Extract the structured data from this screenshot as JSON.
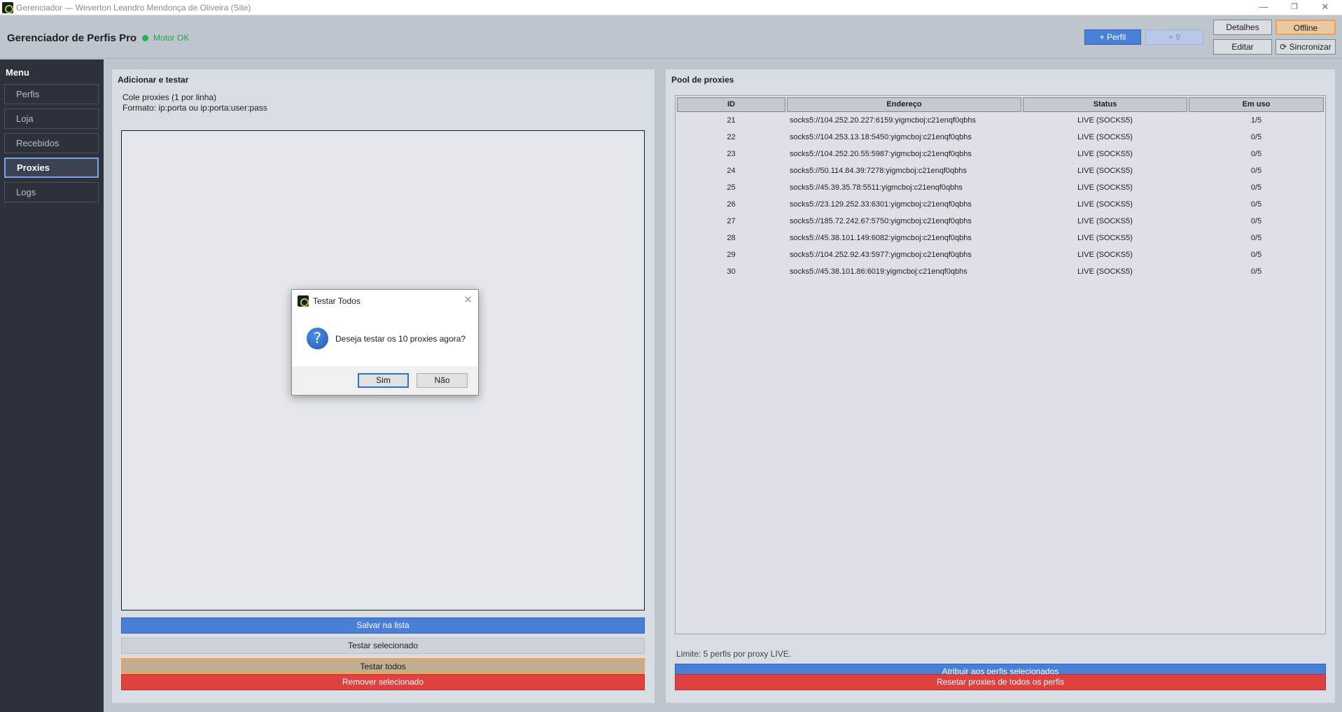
{
  "window": {
    "title": "Gerenciador — Weverton Leandro Mendonça de Oliveira (Site)",
    "minimize": "—",
    "restore": "❐",
    "close": "✕"
  },
  "header": {
    "app_title": "Gerenciador de Perfis Pro",
    "engine_status": "Motor OK",
    "add_profile": "+ Perfil",
    "add_nine": "+ 9",
    "details": "Detalhes",
    "offline": "Offline",
    "edit": "Editar",
    "sync": "⟳ Sincronizar"
  },
  "sidebar": {
    "title": "Menu",
    "items": [
      {
        "label": "Perfis"
      },
      {
        "label": "Loja"
      },
      {
        "label": "Recebidos"
      },
      {
        "label": "Proxies"
      },
      {
        "label": "Logs"
      }
    ]
  },
  "left_panel": {
    "title": "Adicionar e testar",
    "hint1": "Cole proxies (1 por linha)",
    "hint2": "Formato: ip:porta ou ip:porta:user:pass",
    "textarea_value": "",
    "save": "Salvar na lista",
    "test_selected": "Testar selecionado",
    "test_all": "Testar todos",
    "remove": "Remover selecionado"
  },
  "right_panel": {
    "title": "Pool de proxies",
    "columns": [
      "ID",
      "Endereço",
      "Status",
      "Em uso"
    ],
    "rows": [
      {
        "id": "21",
        "address": "socks5://104.252.20.227:6159:yigmcboj:c21enqf0qbhs",
        "status": "LIVE (SOCKS5)",
        "in_use": "1/5"
      },
      {
        "id": "22",
        "address": "socks5://104.253.13.18:5450:yigmcboj:c21enqf0qbhs",
        "status": "LIVE (SOCKS5)",
        "in_use": "0/5"
      },
      {
        "id": "23",
        "address": "socks5://104.252.20.55:5987:yigmcboj:c21enqf0qbhs",
        "status": "LIVE (SOCKS5)",
        "in_use": "0/5"
      },
      {
        "id": "24",
        "address": "socks5://50.114.84.39:7278:yigmcboj:c21enqf0qbhs",
        "status": "LIVE (SOCKS5)",
        "in_use": "0/5"
      },
      {
        "id": "25",
        "address": "socks5://45.39.35.78:5511:yigmcboj:c21enqf0qbhs",
        "status": "LIVE (SOCKS5)",
        "in_use": "0/5"
      },
      {
        "id": "26",
        "address": "socks5://23.129.252.33:6301:yigmcboj:c21enqf0qbhs",
        "status": "LIVE (SOCKS5)",
        "in_use": "0/5"
      },
      {
        "id": "27",
        "address": "socks5://185.72.242.67:5750:yigmcboj:c21enqf0qbhs",
        "status": "LIVE (SOCKS5)",
        "in_use": "0/5"
      },
      {
        "id": "28",
        "address": "socks5://45.38.101.149:6082:yigmcboj:c21enqf0qbhs",
        "status": "LIVE (SOCKS5)",
        "in_use": "0/5"
      },
      {
        "id": "29",
        "address": "socks5://104.252.92.43:5977:yigmcboj:c21enqf0qbhs",
        "status": "LIVE (SOCKS5)",
        "in_use": "0/5"
      },
      {
        "id": "30",
        "address": "socks5://45.38.101.86:6019:yigmcboj:c21enqf0qbhs",
        "status": "LIVE (SOCKS5)",
        "in_use": "0/5"
      }
    ],
    "limit_text": "Limite: 5 perfis por proxy LIVE.",
    "assign": "Atribuir aos perfis selecionados",
    "reset": "Resetar proxies de todos os perfis"
  },
  "dialog": {
    "title": "Testar Todos",
    "close": "✕",
    "icon_glyph": "?",
    "message": "Deseja testar os 10 proxies agora?",
    "yes": "Sim",
    "no": "Não"
  }
}
